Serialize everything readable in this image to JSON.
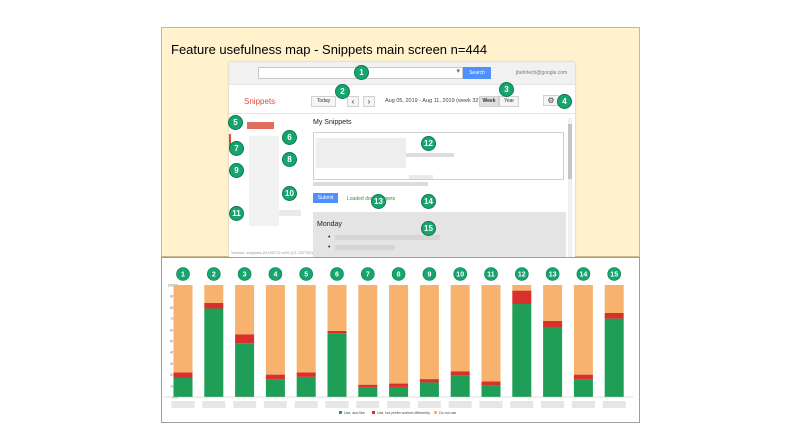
{
  "slide": {
    "title": "Feature usefulness map - Snippets main screen  n=444"
  },
  "app": {
    "brand": "Snippets",
    "search_button": "Search",
    "account": "jbehrlech@google.com",
    "today_button": "Today",
    "prev_glyph": "‹",
    "next_glyph": "›",
    "date_range": "Aug 05, 2019 - Aug 11, 2019 (week 32)",
    "week_button": "Week",
    "year_button": "Year",
    "section_title": "My Snippets",
    "submit_button": "Submit",
    "status_text": "Loaded draft snippets",
    "day_label": "Monday",
    "bullet": "•",
    "version": "Version: snippets-20190712-rc00 (CL 257750)"
  },
  "markers": [
    "1",
    "2",
    "3",
    "4",
    "5",
    "6",
    "7",
    "8",
    "9",
    "10",
    "11",
    "12",
    "13",
    "14",
    "15"
  ],
  "colors": {
    "like": "#1e9e57",
    "differently": "#d9302c",
    "not_use": "#f7b36e",
    "marker": "#17a56e"
  },
  "chart_data": {
    "type": "bar",
    "stacked": true,
    "categories": [
      "1",
      "2",
      "3",
      "4",
      "5",
      "6",
      "7",
      "8",
      "9",
      "10",
      "11",
      "12",
      "13",
      "14",
      "15"
    ],
    "ylim": [
      0,
      100
    ],
    "yticks": [
      "0%",
      "10%",
      "20%",
      "30%",
      "40%",
      "50%",
      "60%",
      "70%",
      "80%",
      "90%",
      "100%"
    ],
    "series": [
      {
        "name": "Use, and like",
        "values": [
          17,
          79,
          48,
          16,
          18,
          57,
          9,
          9,
          13,
          19,
          10,
          83,
          62,
          16,
          70
        ]
      },
      {
        "name": "Use, but prefer worked differently",
        "values": [
          5,
          5,
          8,
          4,
          4,
          2,
          2,
          3,
          3,
          4,
          4,
          12,
          6,
          4,
          5
        ]
      },
      {
        "name": "Do not use",
        "values": [
          78,
          16,
          44,
          80,
          78,
          41,
          89,
          88,
          84,
          77,
          86,
          5,
          32,
          80,
          25
        ]
      }
    ],
    "legend_position": "bottom",
    "grid": false
  }
}
